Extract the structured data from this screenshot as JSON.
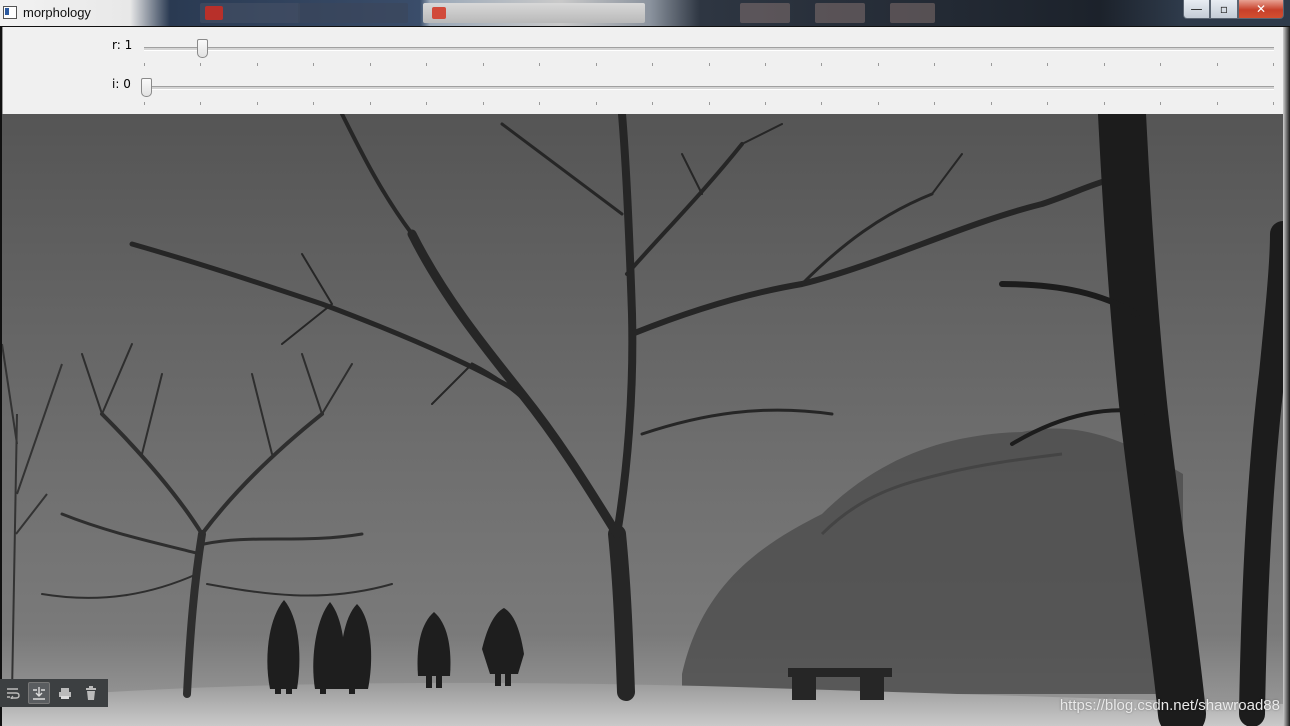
{
  "window": {
    "title": "morphology"
  },
  "trackbars": [
    {
      "label": "r: 1",
      "value": 1
    },
    {
      "label": "i: 0",
      "value": 0
    }
  ],
  "icons": {
    "app": "window-app-icon",
    "minimize": "minimize-icon",
    "maximize": "maximize-icon",
    "close": "close-icon",
    "console": [
      "soft-wrap-icon",
      "scroll-to-end-icon",
      "print-icon",
      "trash-icon"
    ]
  },
  "window_buttons": {
    "minimize": "—",
    "maximize": "▫",
    "close": "✕"
  },
  "image": {
    "watermark": "https://blog.csdn.net/shawroad88"
  },
  "colors": {
    "panel": "#f0f0f0",
    "close_button": "#c7402a",
    "console_toolbar": "#3c3f41"
  }
}
